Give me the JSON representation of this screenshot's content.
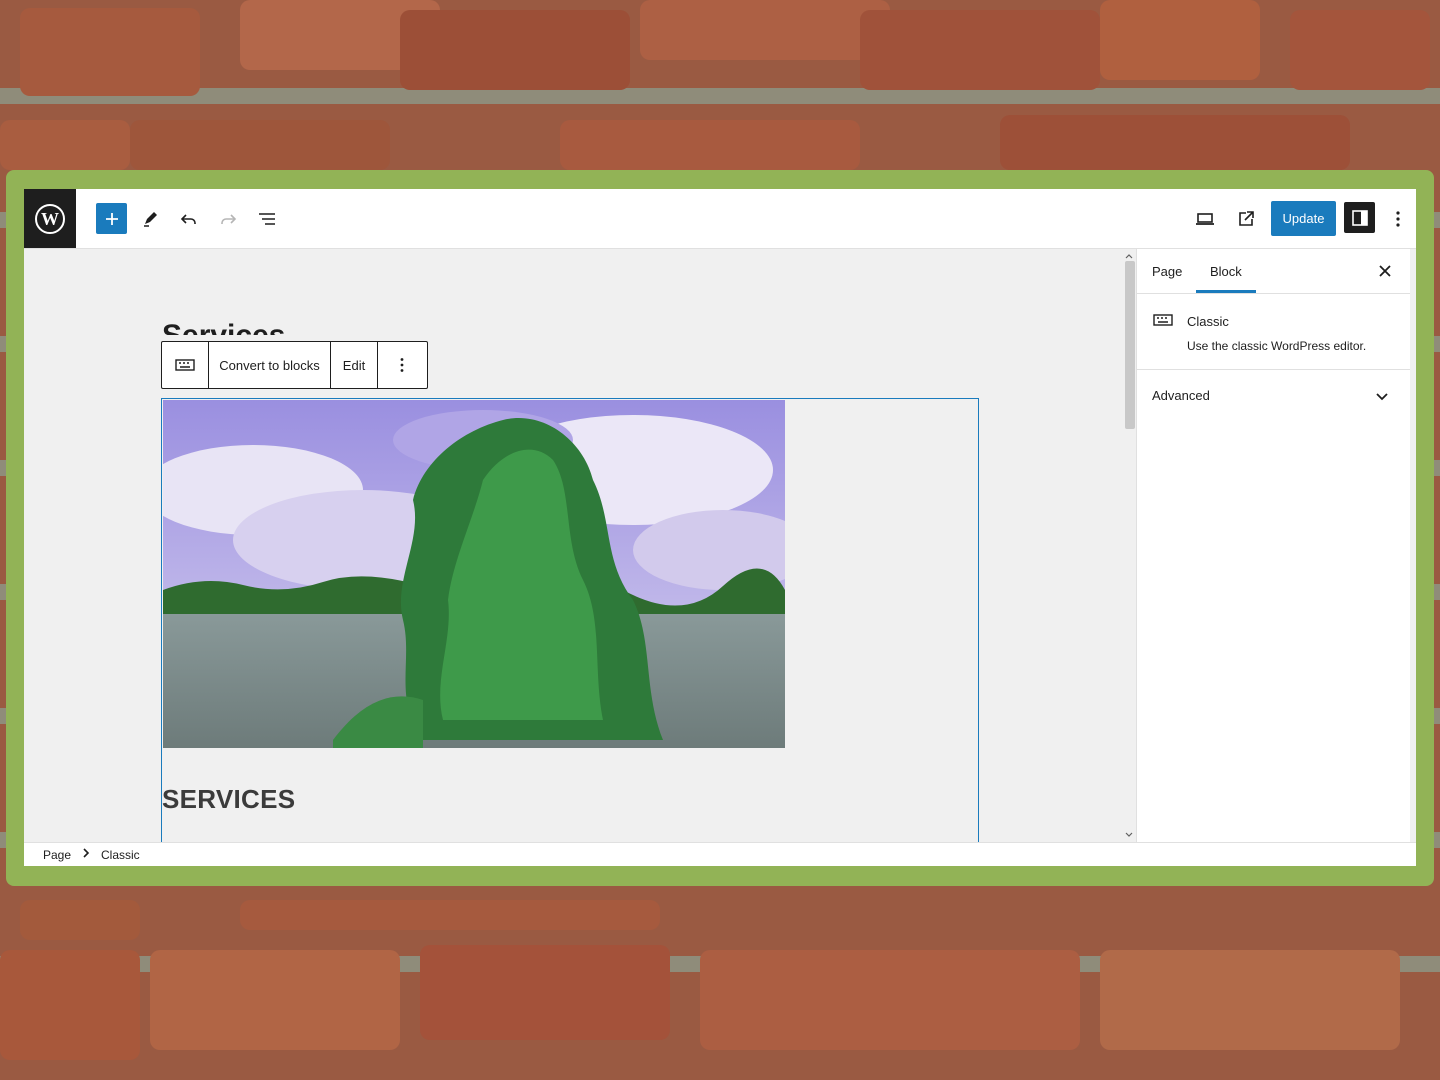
{
  "toolbar": {
    "update_label": "Update"
  },
  "icons": {
    "wp_logo": "wordpress-logo",
    "add": "plus-icon",
    "edit": "pencil-icon",
    "undo": "undo-icon",
    "redo": "redo-icon",
    "outline": "list-view-icon",
    "preview": "desktop-preview-icon",
    "external": "external-link-icon",
    "settings": "settings-sidebar-icon",
    "more": "more-vertical-icon"
  },
  "block_toolbar": {
    "convert_label": "Convert to blocks",
    "edit_label": "Edit"
  },
  "canvas": {
    "heading_peek": "Services",
    "services_heading": "SERVICES"
  },
  "sidebar": {
    "tabs": [
      {
        "label": "Page"
      },
      {
        "label": "Block"
      }
    ],
    "active_tab": "Block",
    "block_card": {
      "title": "Classic",
      "description": "Use the classic WordPress editor."
    },
    "advanced_label": "Advanced"
  },
  "footer": {
    "breadcrumb": [
      "Page",
      "Classic"
    ]
  },
  "colors": {
    "accent": "#1a7bbd",
    "frame": "#92b356",
    "dark": "#1e1e1e"
  }
}
